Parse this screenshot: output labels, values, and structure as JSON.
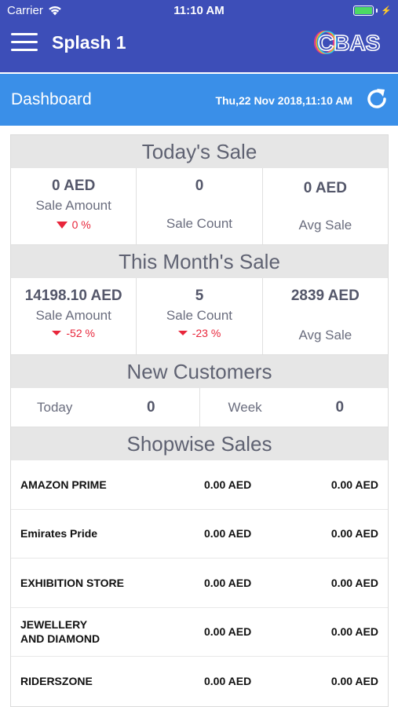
{
  "status": {
    "carrier": "Carrier",
    "time": "11:10 AM"
  },
  "nav": {
    "title": "Splash 1",
    "logo_text": "CBAS"
  },
  "dashboard": {
    "title": "Dashboard",
    "datetime": "Thu,22 Nov 2018,11:10 AM"
  },
  "today": {
    "header": "Today's Sale",
    "sale_amount": {
      "value": "0 AED",
      "label": "Sale Amount",
      "change": "0 %"
    },
    "sale_count": {
      "value": "0",
      "label": "Sale Count"
    },
    "avg_sale": {
      "value": "0 AED",
      "label": "Avg Sale"
    }
  },
  "month": {
    "header": "This Month's Sale",
    "sale_amount": {
      "value": "14198.10 AED",
      "label": "Sale Amount",
      "change": "-52 %"
    },
    "sale_count": {
      "value": "5",
      "label": "Sale Count",
      "change": "-23 %"
    },
    "avg_sale": {
      "value": "2839 AED",
      "label": "Avg Sale"
    }
  },
  "customers": {
    "header": "New Customers",
    "today_label": "Today",
    "today_value": "0",
    "week_label": "Week",
    "week_value": "0"
  },
  "shopwise": {
    "header": "Shopwise Sales",
    "rows": [
      {
        "name": "AMAZON PRIME",
        "value1": "0.00 AED",
        "value2": "0.00 AED"
      },
      {
        "name": "Emirates Pride",
        "value1": "0.00 AED",
        "value2": "0.00 AED"
      },
      {
        "name": "EXHIBITION STORE",
        "value1": "0.00 AED",
        "value2": "0.00 AED"
      },
      {
        "name": "JEWELLERY\nAND  DIAMOND",
        "value1": "0.00 AED",
        "value2": "0.00 AED"
      },
      {
        "name": "RIDERSZONE",
        "value1": "0.00 AED",
        "value2": "0.00 AED"
      }
    ]
  },
  "colors": {
    "nav": "#3d4eb8",
    "dashboard_bar": "#3a8fe8",
    "negative": "#e8263b"
  },
  "icons": {
    "menu": "hamburger-icon",
    "refresh": "refresh-icon",
    "wifi": "wifi-icon",
    "battery": "battery-icon",
    "down": "down-triangle-icon"
  }
}
